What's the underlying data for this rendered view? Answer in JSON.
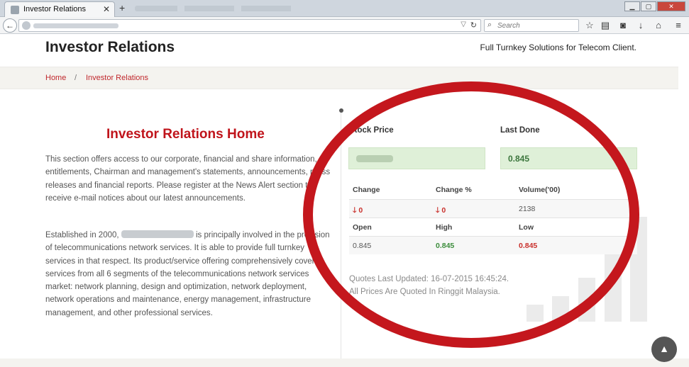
{
  "browser": {
    "tab_title": "Investor Relations",
    "tab_close": "✕",
    "new_tab": "+",
    "search_placeholder": "Search",
    "back_icon": "back-arrow-icon",
    "reload_icon": "reload-icon",
    "toolbar_icons": [
      "star-icon",
      "reading-list-icon",
      "pocket-icon",
      "download-icon",
      "home-icon",
      "menu-icon"
    ]
  },
  "header": {
    "title": "Investor Relations",
    "tagline": "Full Turnkey Solutions for Telecom Client."
  },
  "breadcrumb": {
    "home": "Home",
    "separator": "/",
    "current": "Investor Relations"
  },
  "main": {
    "heading": "Investor Relations Home",
    "para1": "This section offers access to our corporate, financial and share information, entitlements, Chairman and management's statements, announcements, press releases and financial reports. Please register at the News Alert section to receive e-mail notices about our latest announcements.",
    "para2_start": "Established in 2000,",
    "para2_rest": "is principally involved in the provision of telecommunications network services. It is able to provide full turnkey services in that respect. Its product/service offering comprehensively covers services from all 6 segments of the telecommunications network services market: network planning, design and optimization, network deployment, network operations and maintenance, energy management, infrastructure management, and other professional services."
  },
  "stock": {
    "stock_price_label": "Stock Price",
    "last_done_label": "Last Done",
    "last_done_value": "0.845",
    "change_label": "Change",
    "change_pct_label": "Change %",
    "volume_label": "Volume('00)",
    "change_value": "0",
    "change_pct_value": "0",
    "volume_value": "2138",
    "open_label": "Open",
    "high_label": "High",
    "low_label": "Low",
    "open_value": "0.845",
    "high_value": "0.845",
    "low_value": "0.845",
    "updated": "Quotes Last Updated: 16-07-2015 16:45:24.",
    "currency_note": "All Prices Are Quoted In Ringgit Malaysia."
  },
  "colors": {
    "accent_red": "#c0141b",
    "positive_green": "#3c763d",
    "price_box_bg": "#dff0d8"
  }
}
